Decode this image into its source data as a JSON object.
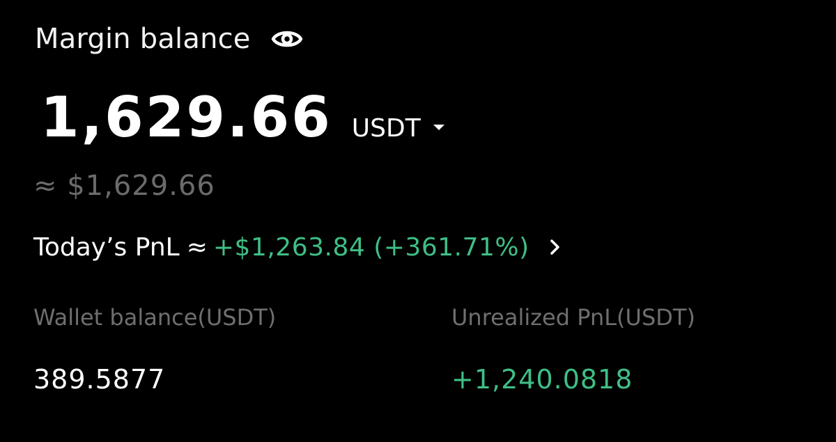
{
  "header": {
    "title": "Margin balance",
    "visibility_icon": "eye-icon"
  },
  "balance": {
    "value": "1,629.66",
    "currency": "USDT",
    "approx": "≈ $1,629.66"
  },
  "pnl": {
    "label": "Today’s PnL",
    "approx_symbol": "≈",
    "value": "+$1,263.84 (+361.71%)"
  },
  "stats": {
    "wallet": {
      "label": "Wallet balance(USDT)",
      "value": "389.5877"
    },
    "unrealized": {
      "label": "Unrealized PnL(USDT)",
      "value": "+1,240.0818"
    }
  },
  "colors": {
    "background": "#000000",
    "primary_text": "#ffffff",
    "secondary_text": "#6b6b6b",
    "positive": "#3fbf86"
  }
}
